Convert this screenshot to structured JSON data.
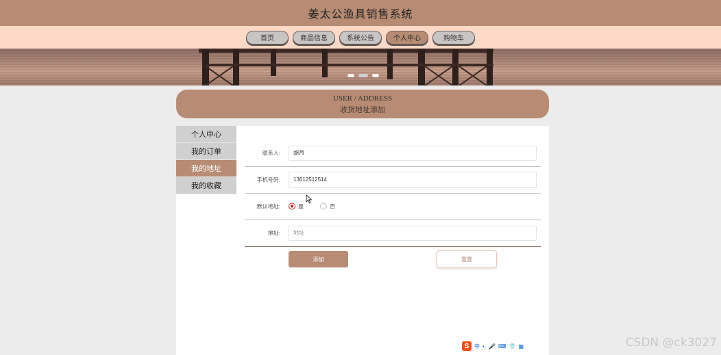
{
  "app": {
    "title": "姜太公渔具销售系统"
  },
  "nav": {
    "items": [
      {
        "label": "首页"
      },
      {
        "label": "商品信息"
      },
      {
        "label": "系统公告"
      },
      {
        "label": "个人中心"
      },
      {
        "label": "购物车"
      }
    ],
    "active_index": 3
  },
  "section": {
    "title_en": "USER / ADDRESS",
    "title_cn": "收货地址添加"
  },
  "sidebar": {
    "items": [
      {
        "label": "个人中心"
      },
      {
        "label": "我的订单"
      },
      {
        "label": "我的地址"
      },
      {
        "label": "我的收藏"
      }
    ],
    "active_index": 2
  },
  "form": {
    "contact": {
      "label": "联系人:",
      "value": "胡月"
    },
    "phone": {
      "label": "手机号码:",
      "value": "13612512514"
    },
    "default_address": {
      "label": "默认地址:",
      "options": [
        {
          "label": "是",
          "checked": true
        },
        {
          "label": "否",
          "checked": false
        }
      ]
    },
    "address": {
      "label": "地址:",
      "placeholder": "地址"
    },
    "add_button": "添加",
    "reset_button": "重置"
  },
  "ime": {
    "logo": "S",
    "mode": "中"
  },
  "watermark": "CSDN @ck3027",
  "colors": {
    "accent": "#b78b74",
    "nav_bg": "#fcd8c6",
    "radio_checked": "#b22222"
  }
}
